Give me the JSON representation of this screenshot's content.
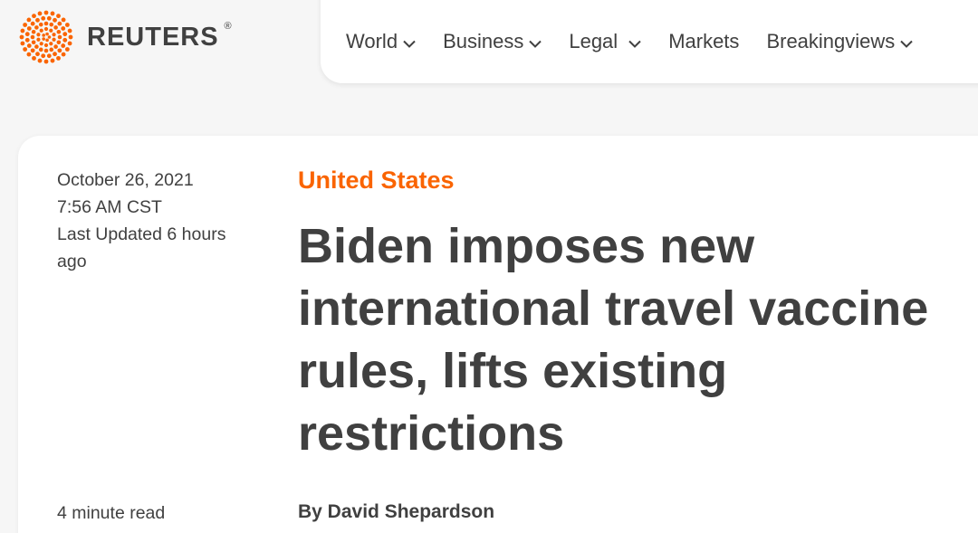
{
  "brand": {
    "name": "REUTERS",
    "registered": "®",
    "logo_color": "#fa6400"
  },
  "nav": {
    "items": [
      {
        "label": "World",
        "has_dropdown": true
      },
      {
        "label": "Business",
        "has_dropdown": true
      },
      {
        "label": "Legal",
        "has_dropdown": true
      },
      {
        "label": "Markets",
        "has_dropdown": false
      },
      {
        "label": "Breakingviews",
        "has_dropdown": true
      }
    ]
  },
  "article": {
    "date": "October 26, 2021",
    "time": "7:56 AM CST",
    "updated": "Last Updated 6 hours ago",
    "read_time": "4 minute read",
    "section": "United States",
    "headline": "Biden imposes new international travel vaccine rules, lifts existing restrictions",
    "byline": "By David Shepardson"
  },
  "colors": {
    "accent": "#fa6400",
    "text": "#404040",
    "background": "#f6f6f6"
  }
}
